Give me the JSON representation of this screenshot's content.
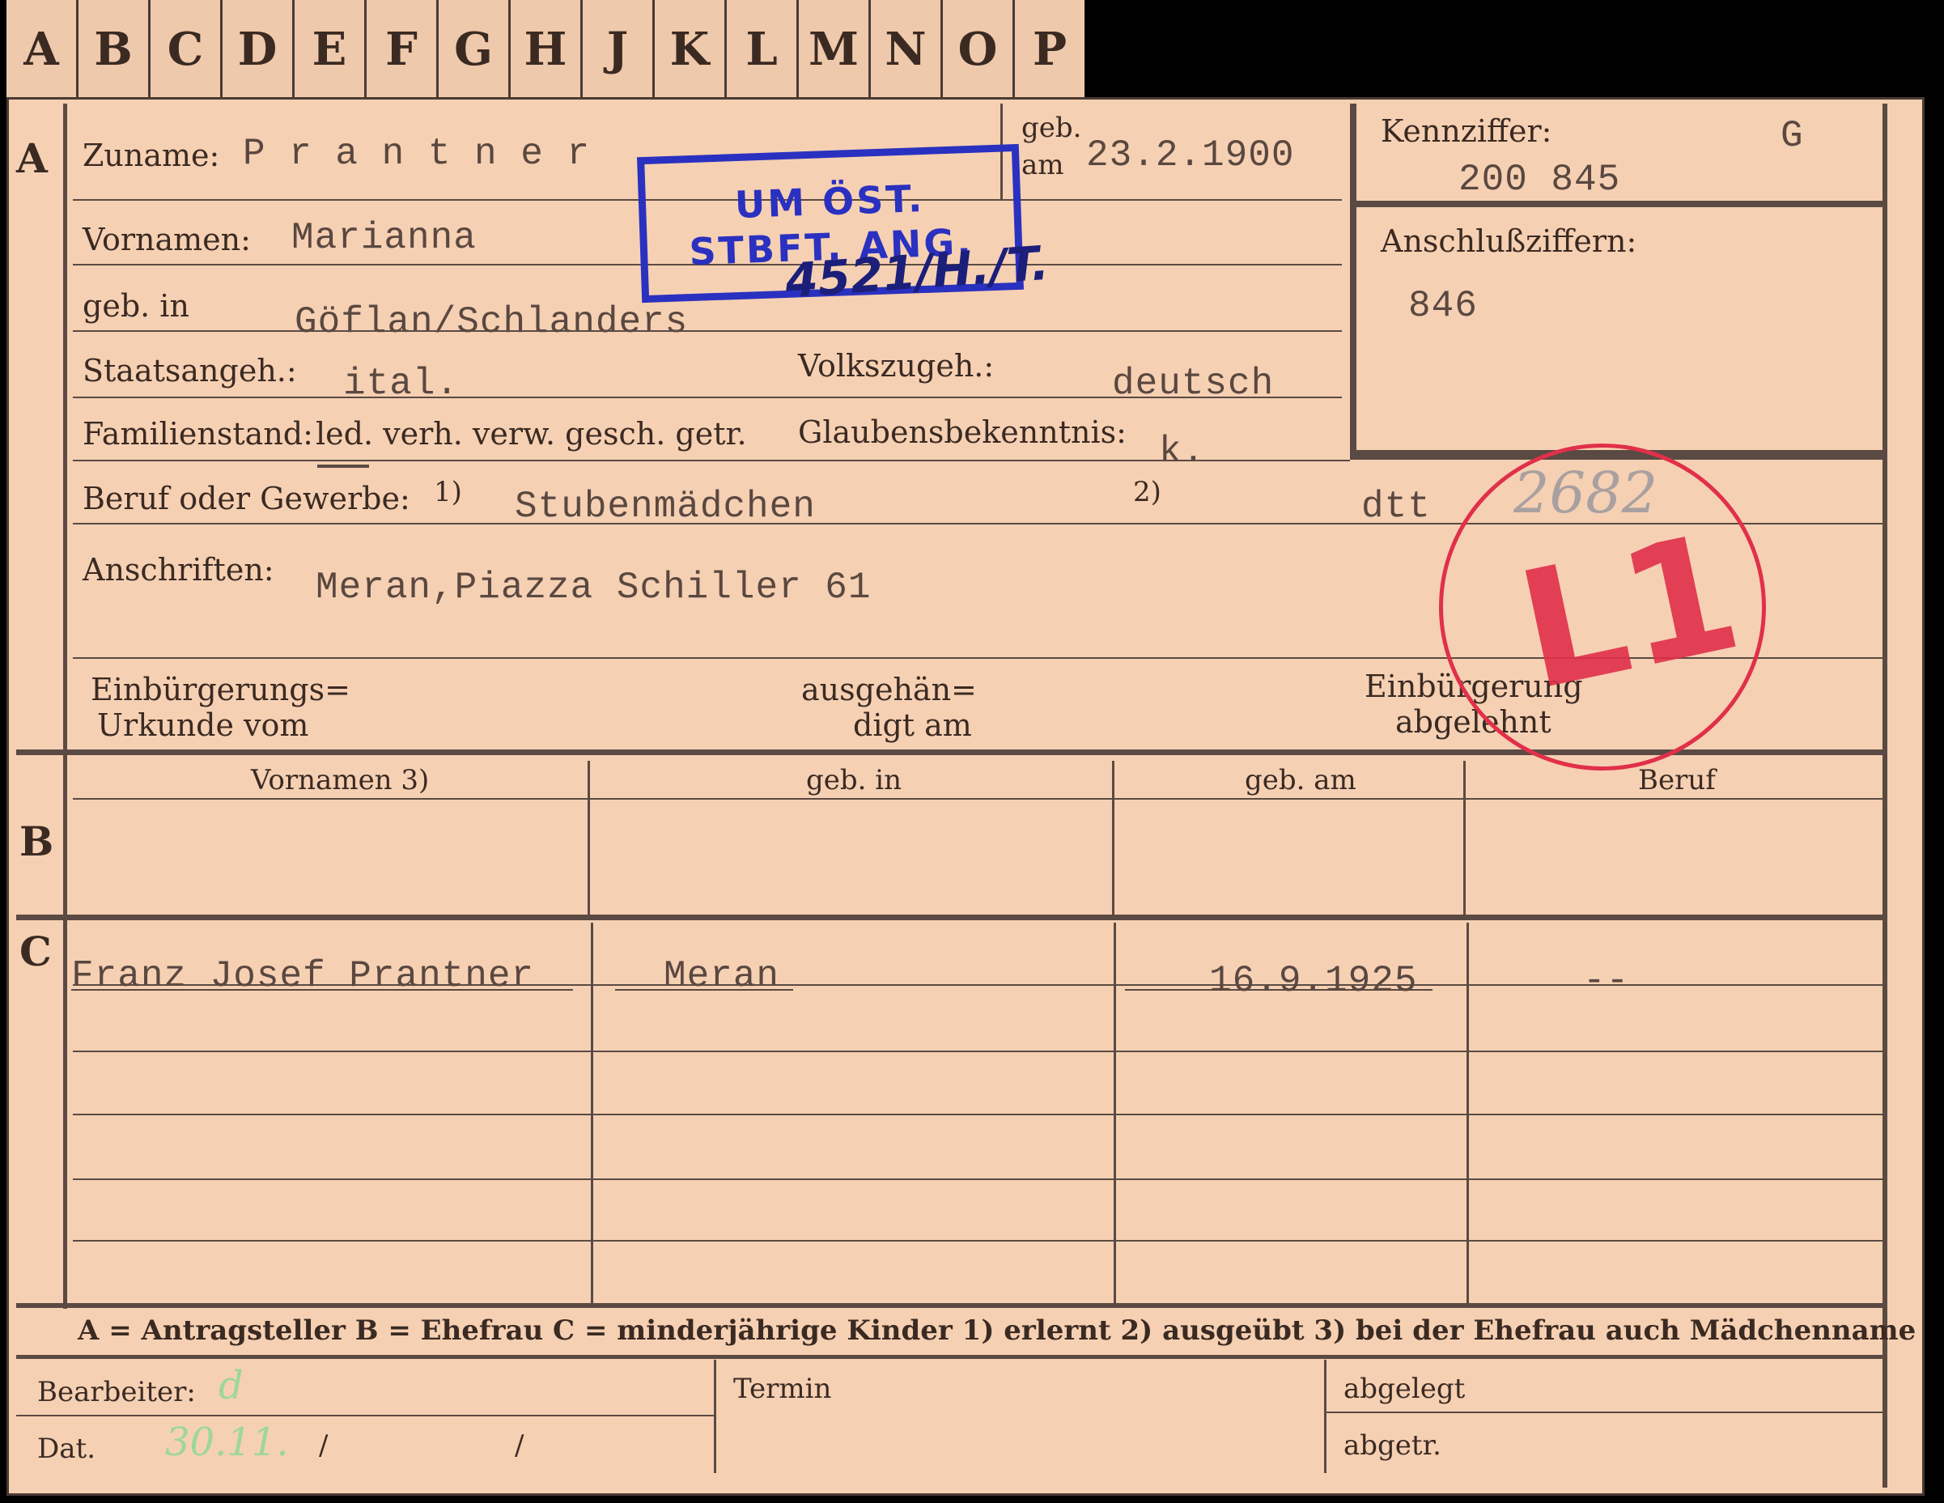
{
  "tabs": [
    "A",
    "B",
    "C",
    "D",
    "E",
    "F",
    "G",
    "H",
    "J",
    "K",
    "L",
    "M",
    "N",
    "O",
    "P"
  ],
  "section_a": {
    "letter": "A",
    "zuname_label": "Zuname:",
    "zuname": "P r a n t n e r",
    "geb_am_label_1": "geb.",
    "geb_am_label_2": "am",
    "geb_am": "23.2.1900",
    "kennziffer_label": "Kennziffer:",
    "kennziffer_code": "G",
    "kennziffer": "200 845",
    "vornamen_label": "Vornamen:",
    "vornamen": "Marianna",
    "geb_in_label": "geb. in",
    "geb_in": "Göflan/Schlanders",
    "anschluss_label": "Anschlußziffern:",
    "anschluss": "846",
    "staatsangeh_label": "Staatsangeh.:",
    "staatsangeh": "ital.",
    "volkszugeh_label": "Volkszugeh.:",
    "volkszugeh": "deutsch",
    "familienstand_label": "Familienstand:",
    "familienstand_options": "led. verh. verw. gesch. getr.",
    "glauben_label": "Glaubensbekenntnis:",
    "glauben": "k.",
    "beruf_label": "Beruf oder Gewerbe:",
    "beruf_note1": "1)",
    "beruf": "Stubenmädchen",
    "beruf_note2": "2)",
    "beruf2": "dtt",
    "anschriften_label": "Anschriften:",
    "anschrift": "Meran,Piazza Schiller 61",
    "einb_label_1": "Einbürgerungs=",
    "einb_label_2": "Urkunde vom",
    "ausgeh_label_1": "ausgehän=",
    "ausgeh_label_2": "digt am",
    "abgelehnt_label_1": "Einbürgerung",
    "abgelehnt_label_2": "abgelehnt"
  },
  "stamps": {
    "blue_line1": "UM ÖST.",
    "blue_line2": "STBFT. ANG.",
    "blue_handwritten": "4521/H./T.",
    "red_number": "2682",
    "red_code": "L1"
  },
  "section_b": {
    "letter": "B",
    "headers": [
      "Vornamen 3)",
      "geb. in",
      "geb. am",
      "Beruf"
    ]
  },
  "section_c": {
    "letter": "C",
    "row": [
      "Franz Josef Prantner",
      "Meran",
      "16.9.1925",
      "--"
    ]
  },
  "legend": "A = Antragsteller   B = Ehefrau   C = minderjährige Kinder   1) erlernt   2) ausgeübt   3) bei der Ehefrau auch Mädchenname",
  "footer": {
    "bearbeiter_label": "Bearbeiter:",
    "bearbeiter": "d",
    "dat_label": "Dat.",
    "dat": "30.11.",
    "dat_sep1": "/",
    "dat_sep2": "/",
    "termin_label": "Termin",
    "abgelegt_label": "abgelegt",
    "abgetr_label": "abgetr."
  },
  "colors": {
    "paper": "#f6d0b3",
    "ink": "#3a2a22",
    "stamp_blue": "#2a31c0",
    "stamp_red": "#e0304a"
  }
}
